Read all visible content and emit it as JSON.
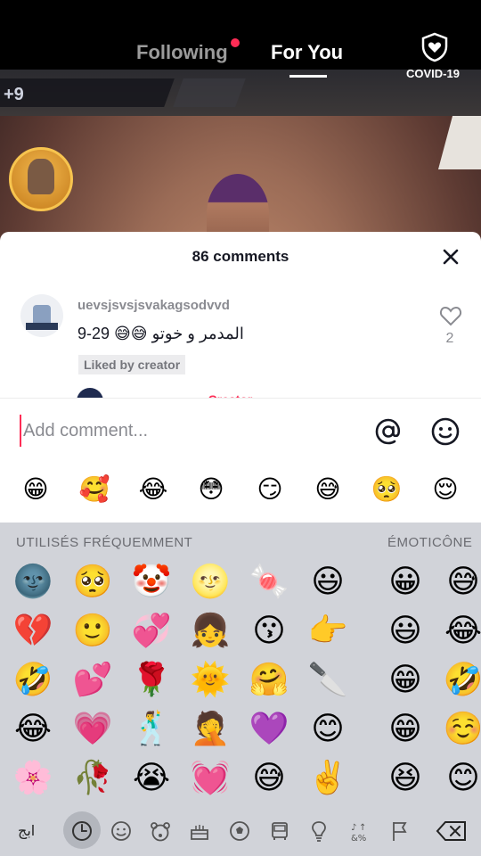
{
  "nav": {
    "tab_following": "Following",
    "tab_for_you": "For You",
    "covid_label": "COVID-19"
  },
  "video_hud": {
    "left_count": "+9"
  },
  "comments": {
    "title": "86 comments",
    "items": [
      {
        "username": "uevsjsvsjsvakagsodvvd",
        "text": "9-29 😅😅 المدمر و خوتو",
        "liked_badge": "Liked by creator",
        "like_count": "2"
      }
    ],
    "next_username": "...",
    "next_creator_tag": "· Creator"
  },
  "input": {
    "placeholder": "Add comment..."
  },
  "quick_emojis": [
    "😁",
    "🥰",
    "😂",
    "😳",
    "😏",
    "😅",
    "🥺",
    "😌"
  ],
  "keyboard": {
    "frequent_label": "UTILISÉS FRÉQUEMMENT",
    "emoticon_label": "ÉMOTICÔNE",
    "frequent_grid": [
      [
        "🌚",
        "🥺",
        "🤡",
        "🌝",
        "🍬",
        "😃"
      ],
      [
        "💔",
        "🙂",
        "💞",
        "👧",
        "😗",
        "👉"
      ],
      [
        "🤣",
        "💕",
        "🌹",
        "🌞",
        "🤗",
        "🔪"
      ],
      [
        "😂",
        "💗",
        "🕺",
        "🤦",
        "💜",
        "😊"
      ],
      [
        "🌸",
        "🥀",
        "😭",
        "💓",
        "😅",
        "✌️"
      ]
    ],
    "emoticon_col1": [
      "😀",
      "😃",
      "😁",
      "😁",
      "😆"
    ],
    "emoticon_col2": [
      "😅",
      "😂",
      "🤣",
      "☺️",
      "😊"
    ],
    "abc_key": "ابج",
    "bottom_icons": [
      "clock-icon",
      "smiley-icon",
      "bear-icon",
      "cake-icon",
      "ball-icon",
      "car-icon",
      "bulb-icon",
      "symbols-icon",
      "flag-icon",
      "backspace-icon"
    ]
  },
  "colors": {
    "accent": "#fe2c55",
    "panel_bg": "#ffffff",
    "keyboard_bg": "#d1d3d9"
  }
}
